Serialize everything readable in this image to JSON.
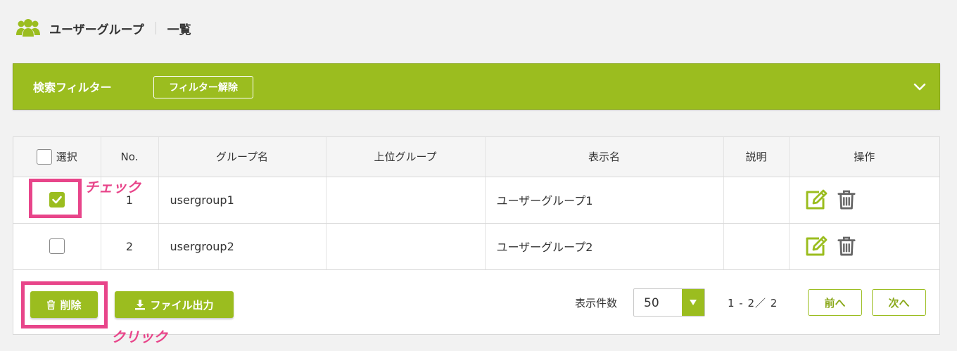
{
  "header": {
    "icon": "users-icon",
    "title": "ユーザーグループ",
    "sub": "一覧"
  },
  "filter": {
    "title": "検索フィルター",
    "clear_label": "フィルター解除",
    "toggle_icon": "chevron-down-icon"
  },
  "table": {
    "headers": {
      "select": "選択",
      "no": "No.",
      "group_name": "グループ名",
      "parent_group": "上位グループ",
      "display_name": "表示名",
      "description": "説明",
      "actions": "操作"
    },
    "rows": [
      {
        "checked": true,
        "no": "1",
        "group_name": "usergroup1",
        "parent_group": "",
        "display_name": "ユーザーグループ1",
        "description": ""
      },
      {
        "checked": false,
        "no": "2",
        "group_name": "usergroup2",
        "parent_group": "",
        "display_name": "ユーザーグループ2",
        "description": ""
      }
    ]
  },
  "footer": {
    "delete_label": "削除",
    "export_label": "ファイル出力",
    "per_page_label": "表示件数",
    "per_page_value": "50",
    "range": "1 - 2／ 2",
    "prev_label": "前へ",
    "next_label": "次へ"
  },
  "annotations": {
    "check": "チェック",
    "click": "クリック"
  },
  "colors": {
    "accent": "#9bbd1f",
    "highlight": "#e8458a",
    "background": "#f2f2f2"
  }
}
